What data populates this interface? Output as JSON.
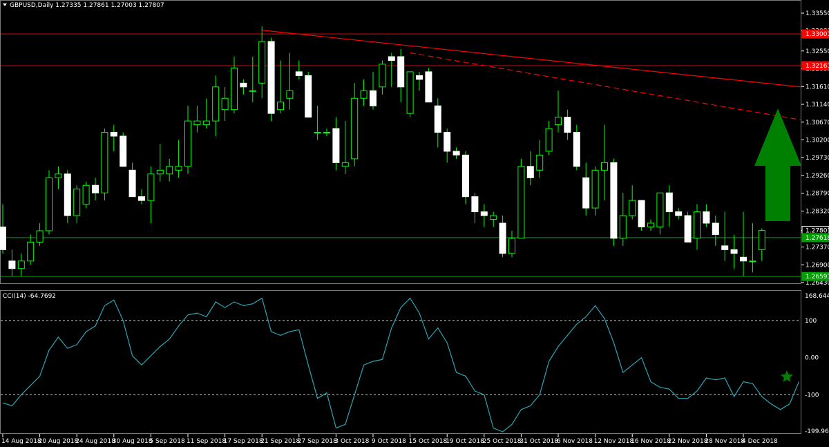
{
  "window": {
    "symbol_title": "GBPUSD,Daily  1.27335 1.27861 1.27003 1.27807",
    "menu_icon": "triangle-down-icon"
  },
  "price_panel": {
    "axis_ticks": [
      "1.33550",
      "1.33081",
      "1.32550",
      "1.32080",
      "1.31610",
      "1.31140",
      "1.30670",
      "1.30200",
      "1.29730",
      "1.29260",
      "1.28790",
      "1.28320",
      "1.27807",
      "1.27370",
      "1.26900",
      "1.26430"
    ],
    "price_tags": [
      {
        "text": "1.33001",
        "color": "#ff0000"
      },
      {
        "text": "1.32161",
        "color": "#ff0000"
      },
      {
        "text": "1.27807",
        "color": "#ffffff"
      },
      {
        "text": "1.27618",
        "color": "#00a000"
      },
      {
        "text": "1.26591",
        "color": "#00a000"
      }
    ],
    "arrow": {
      "direction": "up",
      "color": "#008000",
      "icon": "up-arrow-icon"
    }
  },
  "indicator_panel": {
    "title": "CCI(14) -64.7692",
    "axis_ticks": [
      "168.6443",
      "100",
      "0.00",
      "-100",
      "-199.9609"
    ],
    "levels": [
      100,
      -100
    ],
    "star": {
      "color": "#008000",
      "icon": "star-icon"
    }
  },
  "time_axis": {
    "labels": [
      "14 Aug 2018",
      "20 Aug 2018",
      "24 Aug 2018",
      "30 Aug 2018",
      "5 Sep 2018",
      "11 Sep 2018",
      "17 Sep 2018",
      "21 Sep 2018",
      "27 Sep 2018",
      "3 Oct 2018",
      "9 Oct 2018",
      "15 Oct 2018",
      "19 Oct 2018",
      "25 Oct 2018",
      "31 Oct 2018",
      "6 Nov 2018",
      "12 Nov 2018",
      "16 Nov 2018",
      "22 Nov 2018",
      "28 Nov 2018",
      "4 Dec 2018"
    ]
  },
  "chart_data": {
    "type": "candlestick",
    "series": [
      {
        "name": "GBPUSD,Daily",
        "type": "candlestick",
        "ohlc": [
          [
            1.279,
            1.285,
            1.272,
            1.273
          ],
          [
            1.27,
            1.273,
            1.266,
            1.268
          ],
          [
            1.268,
            1.272,
            1.266,
            1.27
          ],
          [
            1.27,
            1.277,
            1.269,
            1.275
          ],
          [
            1.275,
            1.28,
            1.274,
            1.278
          ],
          [
            1.278,
            1.294,
            1.277,
            1.292
          ],
          [
            1.292,
            1.295,
            1.289,
            1.293
          ],
          [
            1.293,
            1.294,
            1.28,
            1.282
          ],
          [
            1.282,
            1.29,
            1.28,
            1.289
          ],
          [
            1.285,
            1.291,
            1.284,
            1.29
          ],
          [
            1.29,
            1.292,
            1.286,
            1.288
          ],
          [
            1.288,
            1.305,
            1.286,
            1.304
          ],
          [
            1.304,
            1.306,
            1.299,
            1.303
          ],
          [
            1.303,
            1.304,
            1.295,
            1.295
          ],
          [
            1.294,
            1.296,
            1.287,
            1.287
          ],
          [
            1.287,
            1.289,
            1.285,
            1.286
          ],
          [
            1.286,
            1.295,
            1.28,
            1.293
          ],
          [
            1.293,
            1.301,
            1.291,
            1.294
          ],
          [
            1.293,
            1.297,
            1.291,
            1.295
          ],
          [
            1.294,
            1.302,
            1.292,
            1.295
          ],
          [
            1.295,
            1.311,
            1.293,
            1.307
          ],
          [
            1.306,
            1.311,
            1.304,
            1.307
          ],
          [
            1.306,
            1.313,
            1.305,
            1.307
          ],
          [
            1.307,
            1.319,
            1.303,
            1.316
          ],
          [
            1.31,
            1.316,
            1.307,
            1.313
          ],
          [
            1.31,
            1.324,
            1.309,
            1.321
          ],
          [
            1.317,
            1.318,
            1.314,
            1.316
          ],
          [
            1.315,
            1.324,
            1.312,
            1.315
          ],
          [
            1.317,
            1.332,
            1.313,
            1.328
          ],
          [
            1.328,
            1.329,
            1.307,
            1.309
          ],
          [
            1.31,
            1.323,
            1.309,
            1.312
          ],
          [
            1.313,
            1.325,
            1.31,
            1.315
          ],
          [
            1.32,
            1.323,
            1.318,
            1.319
          ],
          [
            1.319,
            1.32,
            1.308,
            1.308
          ],
          [
            1.304,
            1.311,
            1.302,
            1.304
          ],
          [
            1.304,
            1.305,
            1.303,
            1.304
          ],
          [
            1.305,
            1.308,
            1.294,
            1.296
          ],
          [
            1.295,
            1.307,
            1.293,
            1.296
          ],
          [
            1.297,
            1.317,
            1.295,
            1.313
          ],
          [
            1.313,
            1.318,
            1.311,
            1.315
          ],
          [
            1.315,
            1.32,
            1.31,
            1.311
          ],
          [
            1.316,
            1.323,
            1.314,
            1.322
          ],
          [
            1.324,
            1.325,
            1.316,
            1.323
          ],
          [
            1.324,
            1.326,
            1.312,
            1.316
          ],
          [
            1.309,
            1.314,
            1.308,
            1.32
          ],
          [
            1.319,
            1.32,
            1.315,
            1.318
          ],
          [
            1.32,
            1.321,
            1.312,
            1.312
          ],
          [
            1.311,
            1.313,
            1.3,
            1.304
          ],
          [
            1.304,
            1.305,
            1.296,
            1.299
          ],
          [
            1.299,
            1.3,
            1.297,
            1.298
          ],
          [
            1.298,
            1.299,
            1.285,
            1.287
          ],
          [
            1.287,
            1.288,
            1.28,
            1.283
          ],
          [
            1.283,
            1.285,
            1.279,
            1.282
          ],
          [
            1.281,
            1.283,
            1.279,
            1.282
          ],
          [
            1.28,
            1.282,
            1.271,
            1.272
          ],
          [
            1.272,
            1.278,
            1.271,
            1.276
          ],
          [
            1.276,
            1.297,
            1.276,
            1.295
          ],
          [
            1.295,
            1.299,
            1.29,
            1.292
          ],
          [
            1.294,
            1.302,
            1.292,
            1.298
          ],
          [
            1.299,
            1.307,
            1.298,
            1.305
          ],
          [
            1.306,
            1.315,
            1.304,
            1.308
          ],
          [
            1.308,
            1.31,
            1.302,
            1.304
          ],
          [
            1.304,
            1.306,
            1.294,
            1.295
          ],
          [
            1.292,
            1.296,
            1.282,
            1.284
          ],
          [
            1.284,
            1.295,
            1.282,
            1.294
          ],
          [
            1.294,
            1.306,
            1.286,
            1.296
          ],
          [
            1.296,
            1.297,
            1.274,
            1.276
          ],
          [
            1.276,
            1.288,
            1.274,
            1.282
          ],
          [
            1.282,
            1.29,
            1.281,
            1.286
          ],
          [
            1.286,
            1.286,
            1.278,
            1.279
          ],
          [
            1.279,
            1.281,
            1.278,
            1.28
          ],
          [
            1.279,
            1.288,
            1.277,
            1.288
          ],
          [
            1.288,
            1.29,
            1.279,
            1.283
          ],
          [
            1.283,
            1.284,
            1.281,
            1.282
          ],
          [
            1.282,
            1.283,
            1.275,
            1.275
          ],
          [
            1.276,
            1.285,
            1.273,
            1.283
          ],
          [
            1.283,
            1.285,
            1.279,
            1.28
          ],
          [
            1.28,
            1.282,
            1.274,
            1.277
          ],
          [
            1.274,
            1.283,
            1.27,
            1.273
          ],
          [
            1.273,
            1.277,
            1.268,
            1.272
          ],
          [
            1.271,
            1.283,
            1.266,
            1.27
          ],
          [
            1.27,
            1.28,
            1.267,
            1.27
          ],
          [
            1.273,
            1.2786,
            1.27,
            1.2781
          ]
        ]
      },
      {
        "name": "CCI(14)",
        "type": "line",
        "color": "#2aa6b5",
        "values": [
          -122,
          -130,
          -100,
          -75,
          -50,
          20,
          55,
          25,
          35,
          70,
          85,
          140,
          155,
          100,
          5,
          -20,
          5,
          30,
          50,
          85,
          115,
          120,
          110,
          150,
          135,
          150,
          140,
          145,
          160,
          70,
          60,
          70,
          75,
          -20,
          -110,
          -95,
          -190,
          -180,
          -100,
          -20,
          -10,
          -5,
          80,
          135,
          160,
          120,
          50,
          80,
          40,
          -40,
          -50,
          -90,
          -100,
          -190,
          -200,
          -180,
          -140,
          -130,
          -100,
          -10,
          30,
          60,
          90,
          110,
          140,
          105,
          40,
          -40,
          -20,
          0,
          -65,
          -80,
          -85,
          -110,
          -110,
          -90,
          -55,
          -60,
          -55,
          -105,
          -65,
          -70,
          -105,
          -125,
          -140,
          -125,
          -65
        ]
      }
    ],
    "hlines": [
      {
        "y": 1.33001,
        "color": "#ff0000",
        "style": "solid"
      },
      {
        "y": 1.32161,
        "color": "#ff0000",
        "style": "solid"
      },
      {
        "y": 1.27618,
        "color": "#00a000",
        "style": "solid"
      },
      {
        "y": 1.26591,
        "color": "#00a000",
        "style": "solid"
      }
    ],
    "trendlines": [
      {
        "from": [
          28,
          1.331
        ],
        "to": [
          "end",
          1.316
        ],
        "color": "#ff0000",
        "style": "solid"
      },
      {
        "from": [
          44,
          1.325
        ],
        "to": [
          "end",
          1.3073
        ],
        "color": "#ff0000",
        "style": "dashed"
      }
    ],
    "ylim_price": [
      1.2643,
      1.3355
    ],
    "ylim_cci": [
      -199.9609,
      168.6443
    ],
    "grid": false,
    "colors": {
      "bull": "#000000",
      "bull_border": "#00ff00",
      "bear": "#ffffff",
      "wick": "#00ff00",
      "background": "#000000",
      "foreground": "#ffffff"
    }
  }
}
